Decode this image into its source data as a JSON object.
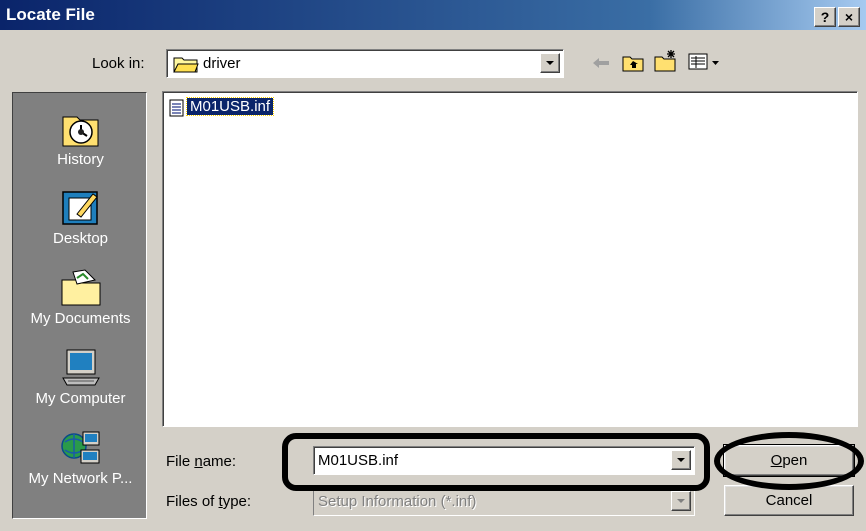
{
  "window": {
    "title": "Locate File",
    "help_button": "?",
    "close_button": "×"
  },
  "toolbar": {
    "look_in_label": "Look in:",
    "look_in_value": "driver"
  },
  "places": [
    {
      "label": "History",
      "icon": "history-icon"
    },
    {
      "label": "Desktop",
      "icon": "desktop-icon"
    },
    {
      "label": "My Documents",
      "icon": "my-documents-icon"
    },
    {
      "label": "My Computer",
      "icon": "my-computer-icon"
    },
    {
      "label": "My Network P...",
      "icon": "my-network-places-icon"
    }
  ],
  "files": [
    {
      "name": "M01USB.inf",
      "selected": true
    }
  ],
  "form": {
    "file_name_label": "File name:",
    "file_name_value": "M01USB.inf",
    "files_of_type_label": "Files of type:",
    "files_of_type_value": "Setup Information (*.inf)"
  },
  "buttons": {
    "open": "Open",
    "cancel": "Cancel"
  }
}
